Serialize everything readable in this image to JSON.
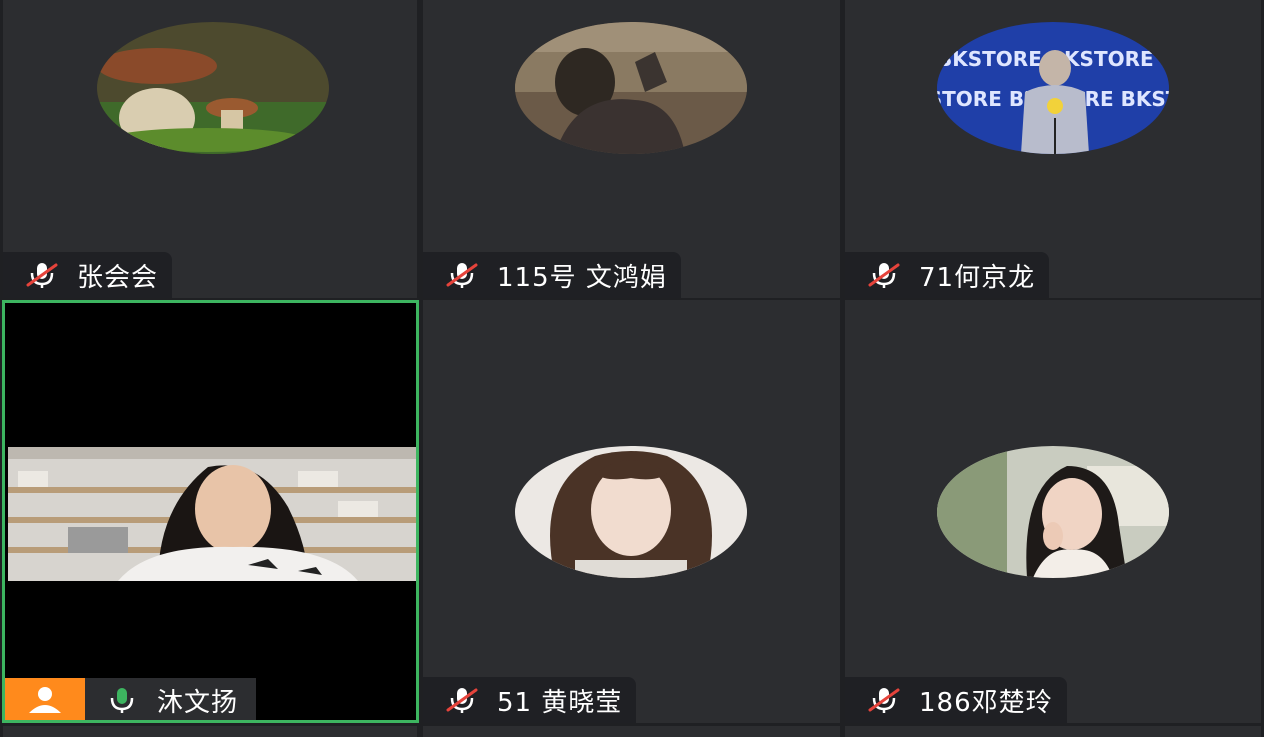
{
  "participants": [
    {
      "name": "张会会",
      "mic": "muted",
      "avatar": "mushroom-photo"
    },
    {
      "name": "115号 文鸿娟",
      "mic": "muted",
      "avatar": "person-photo"
    },
    {
      "name": "71何京龙",
      "mic": "muted",
      "avatar": "stage-photo",
      "avatar_text": "BKSTORE BKSTORE BKSTORE"
    },
    {
      "name": "沐文扬",
      "mic": "active",
      "avatar": "live-video",
      "is_speaking": true
    },
    {
      "name": "51 黄晓莹",
      "mic": "muted",
      "avatar": "portrait-photo"
    },
    {
      "name": "186邓楚玲",
      "mic": "muted",
      "avatar": "portrait-photo"
    }
  ],
  "colors": {
    "tile_bg": "#2c2d30",
    "active_border": "#3db560",
    "host_badge": "#ff8a1c",
    "muted_red": "#e5433b",
    "mic_active_green": "#3db560"
  }
}
